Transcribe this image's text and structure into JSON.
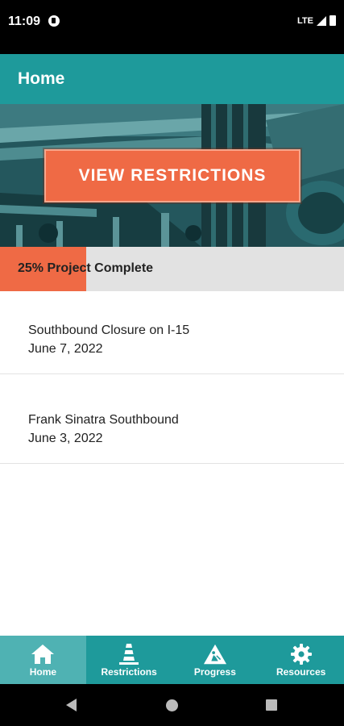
{
  "status_bar": {
    "time": "11:09",
    "network": "LTE"
  },
  "app_bar": {
    "title": "Home"
  },
  "hero": {
    "button_label": "VIEW RESTRICTIONS"
  },
  "progress": {
    "label": "25% Project Complete",
    "percent": 25,
    "fill_color": "#ef6a45",
    "track_color": "#e2e2e2"
  },
  "updates": [
    {
      "title": "Southbound Closure on I-15",
      "date": "June 7, 2022"
    },
    {
      "title": "Frank Sinatra Southbound",
      "date": "June 3, 2022"
    }
  ],
  "bottom_nav": {
    "items": [
      {
        "label": "Home",
        "icon": "home-icon",
        "active": true
      },
      {
        "label": "Restrictions",
        "icon": "traffic-cone-icon",
        "active": false
      },
      {
        "label": "Progress",
        "icon": "construction-sign-icon",
        "active": false
      },
      {
        "label": "Resources",
        "icon": "gear-icon",
        "active": false
      }
    ]
  },
  "colors": {
    "primary": "#1e9a9b",
    "accent": "#ef6a45",
    "nav_active": "#4fb2b3"
  }
}
